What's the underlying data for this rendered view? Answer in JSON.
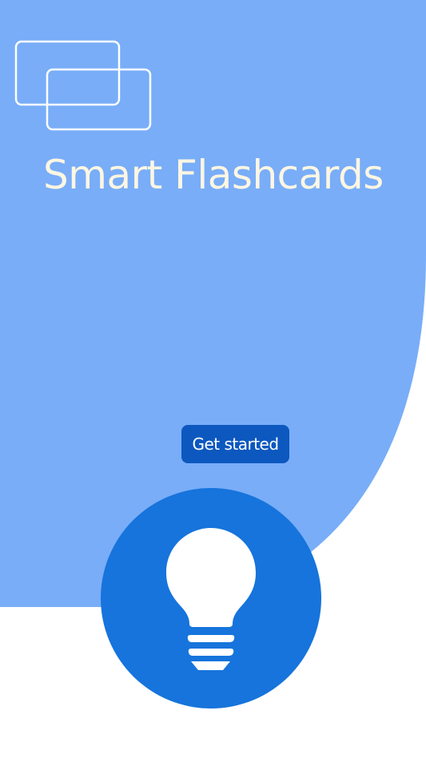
{
  "app": {
    "title": "Smart Flashcards"
  },
  "actions": {
    "get_started_label": "Get started"
  },
  "icons": {
    "logo": "flashcards-icon",
    "feature": "lightbulb-icon"
  },
  "colors": {
    "hero_background": "#79adf8",
    "title_text": "#fdf6e2",
    "button_background": "#0c58bf",
    "button_text": "#ffffff",
    "circle_background": "#1674dc",
    "icon_stroke": "#ffffff",
    "page_background": "#ffffff"
  }
}
